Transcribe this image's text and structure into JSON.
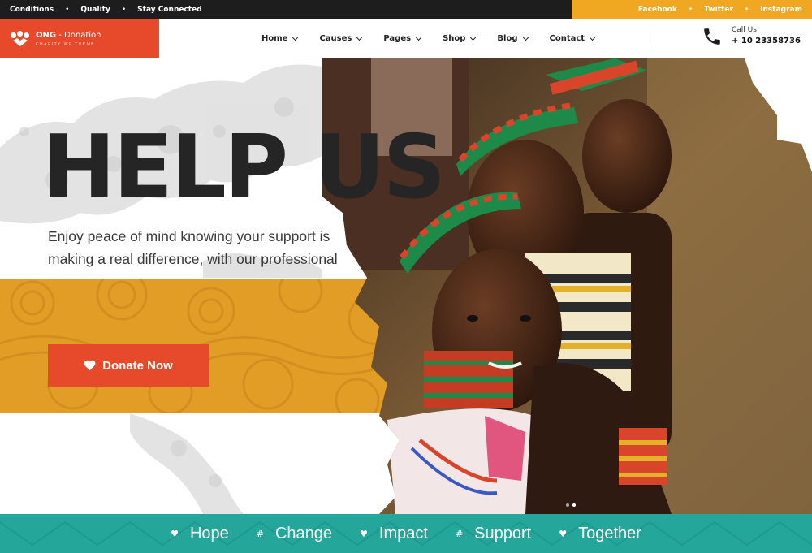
{
  "topbar": {
    "links": [
      "Conditions",
      "Quality",
      "Stay Connected"
    ],
    "social": [
      "Facebook",
      "Twitter",
      "Instagram"
    ]
  },
  "header": {
    "logo_name_bold": "ONG",
    "logo_name_rest": " - Donation",
    "logo_tagline": "CHARITY WP THEME",
    "nav": [
      "Home",
      "Causes",
      "Pages",
      "Shop",
      "Blog",
      "Contact"
    ],
    "call_label": "Call Us",
    "call_number": "+ 10 23358736"
  },
  "hero": {
    "headline": "HELP US",
    "subtitle": "Enjoy peace of mind knowing your support is making a real difference, with our professional",
    "donate_label": "Donate Now"
  },
  "ticker": [
    {
      "symbol": "♥",
      "word": "Hope"
    },
    {
      "symbol": "#",
      "word": "Change"
    },
    {
      "symbol": "♥",
      "word": "Impact"
    },
    {
      "symbol": "#",
      "word": "Support"
    },
    {
      "symbol": "♥",
      "word": "Together"
    }
  ],
  "colors": {
    "brand_red": "#e64a2a",
    "accent_orange": "#f0a823",
    "band_orange": "#e29d26",
    "teal": "#24a69b",
    "dark": "#1d1d1d"
  }
}
